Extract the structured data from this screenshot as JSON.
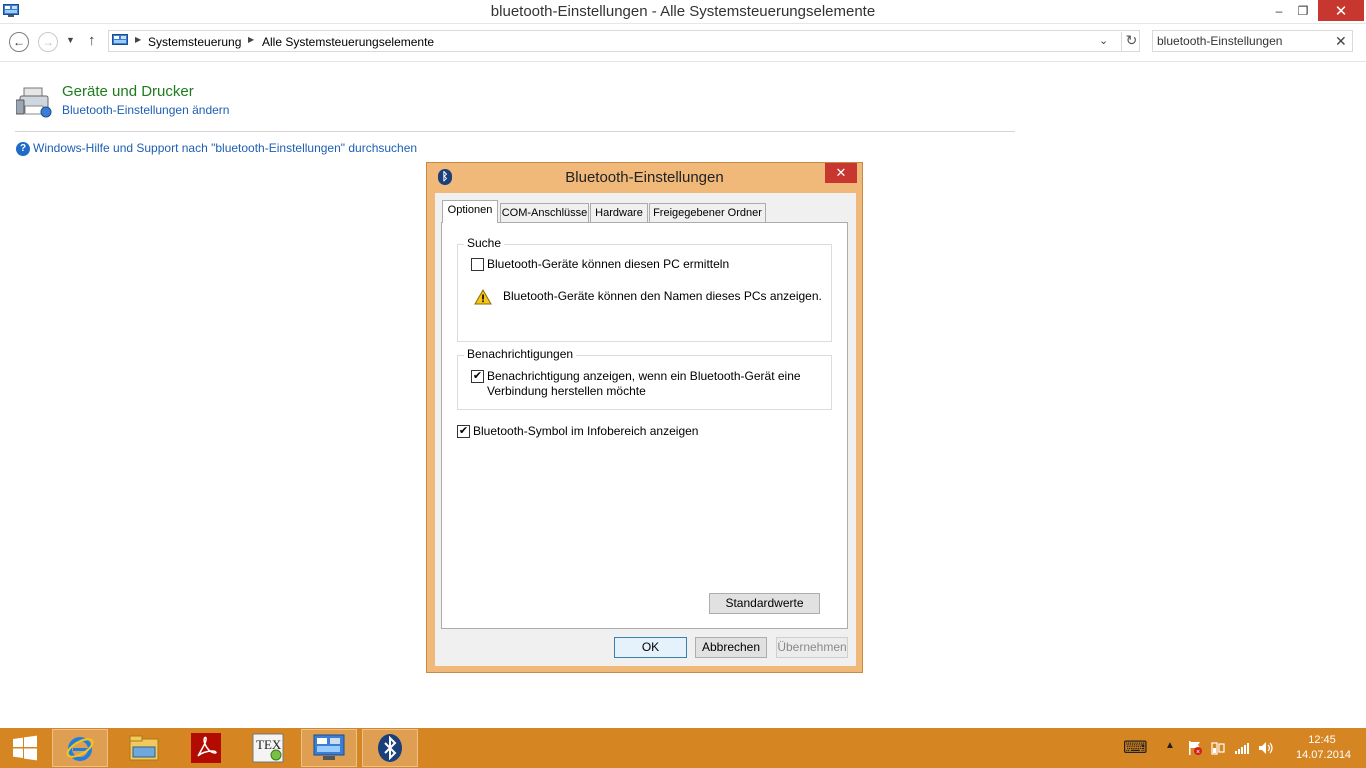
{
  "window": {
    "title": "bluetooth-Einstellungen - Alle Systemsteuerungselemente",
    "controls": {
      "minimize": "–",
      "maximize": "❐",
      "close": "✕"
    }
  },
  "address_bar": {
    "back": "←",
    "forward": "→",
    "up": "↑",
    "breadcrumbs": [
      "Systemsteuerung",
      "Alle Systemsteuerungselemente"
    ],
    "search_value": "bluetooth-Einstellungen",
    "clear": "✕",
    "refresh": "↻"
  },
  "results": {
    "category_title": "Geräte und Drucker",
    "task_link": "Bluetooth-Einstellungen ändern",
    "help_link": "Windows-Hilfe und Support nach \"bluetooth-Einstellungen\" durchsuchen"
  },
  "dialog": {
    "title": "Bluetooth-Einstellungen",
    "close": "✕",
    "tabs": [
      "Optionen",
      "COM-Anschlüsse",
      "Hardware",
      "Freigegebener Ordner"
    ],
    "active_tab": "Optionen",
    "search_group": {
      "label": "Suche",
      "checkbox_label": "Bluetooth-Geräte können diesen PC ermitteln",
      "checkbox_checked": false,
      "warning_text": "Bluetooth-Geräte können den Namen dieses PCs anzeigen."
    },
    "notifications_group": {
      "label": "Benachrichtigungen",
      "checkbox_label_line1": "Benachrichtigung anzeigen, wenn ein Bluetooth-Gerät eine",
      "checkbox_label_line2": "Verbindung herstellen möchte",
      "checkbox_checked": true
    },
    "tray_icon_checkbox": {
      "label": "Bluetooth-Symbol im Infobereich anzeigen",
      "checked": true
    },
    "defaults_button": "Standardwerte",
    "ok_button": "OK",
    "cancel_button": "Abbrechen",
    "apply_button": "Übernehmen",
    "apply_enabled": false
  },
  "taskbar": {
    "apps": [
      "start-icon",
      "internet-explorer-icon",
      "file-explorer-icon",
      "adobe-reader-icon",
      "tex-icon",
      "control-panel-icon",
      "bluetooth-icon"
    ],
    "tex_label": "TEX",
    "tray": {
      "keyboard": "⌨",
      "chevron": "▲"
    },
    "clock_time": "12:45",
    "clock_date": "14.07.2014"
  },
  "colors": {
    "dialog_frame": "#f0b97a",
    "taskbar": "#d68523",
    "close_red": "#c7372f",
    "link_blue": "#1c5fb5",
    "category_green": "#1e7b1e"
  }
}
